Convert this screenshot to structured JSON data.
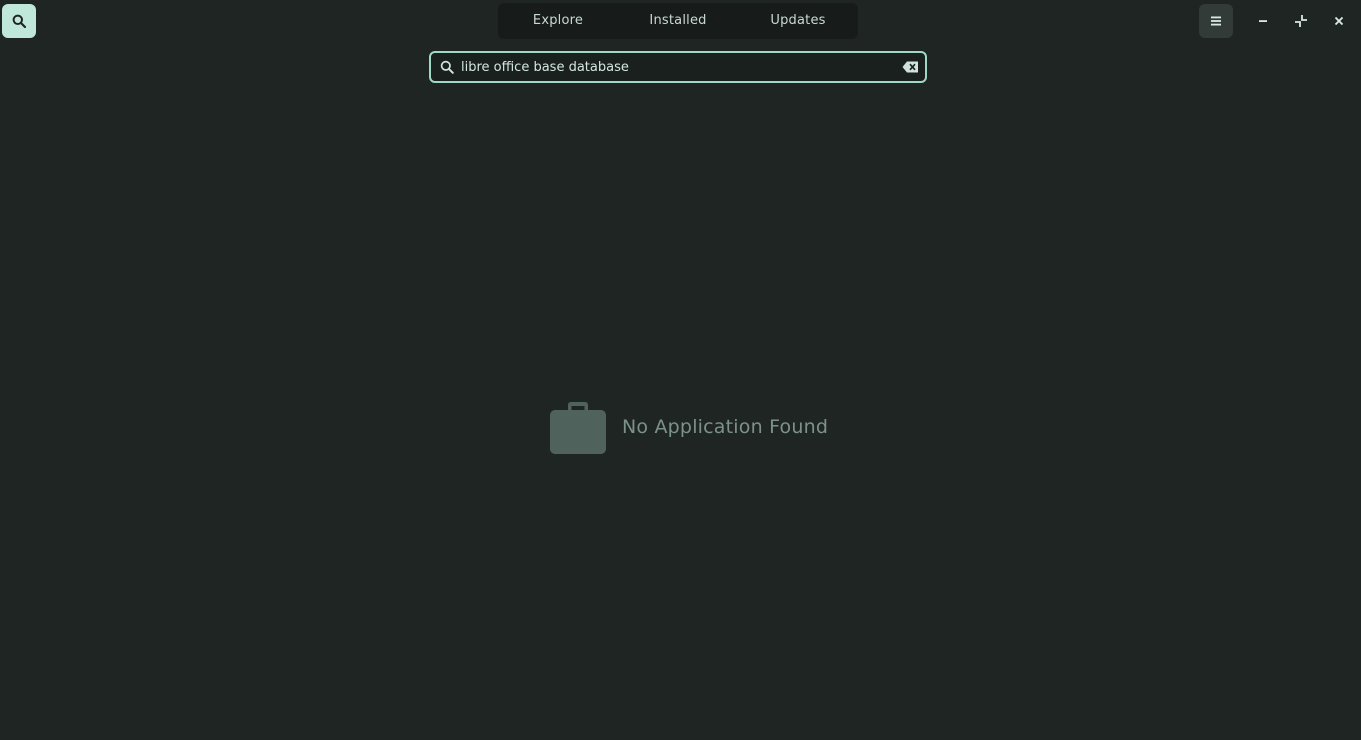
{
  "header": {
    "search_toggle_icon": "search-icon",
    "tabs": [
      {
        "label": "Explore"
      },
      {
        "label": "Installed"
      },
      {
        "label": "Updates"
      }
    ],
    "menu_icon": "hamburger-menu-icon",
    "window_controls": {
      "minimize_icon": "minimize-icon",
      "restore_icon": "restore-icon",
      "close_icon": "close-icon"
    }
  },
  "search": {
    "value": "libre office base database",
    "placeholder": "",
    "lead_icon": "search-icon",
    "clear_icon": "clear-text-icon"
  },
  "main": {
    "empty_icon": "briefcase-icon",
    "empty_message": "No Application Found"
  },
  "colors": {
    "background": "#1f2523",
    "accent": "#9fd8c6",
    "search_toggle_active": "#bfe8da",
    "muted_text": "#7d918b",
    "empty_icon": "#4f625c"
  }
}
